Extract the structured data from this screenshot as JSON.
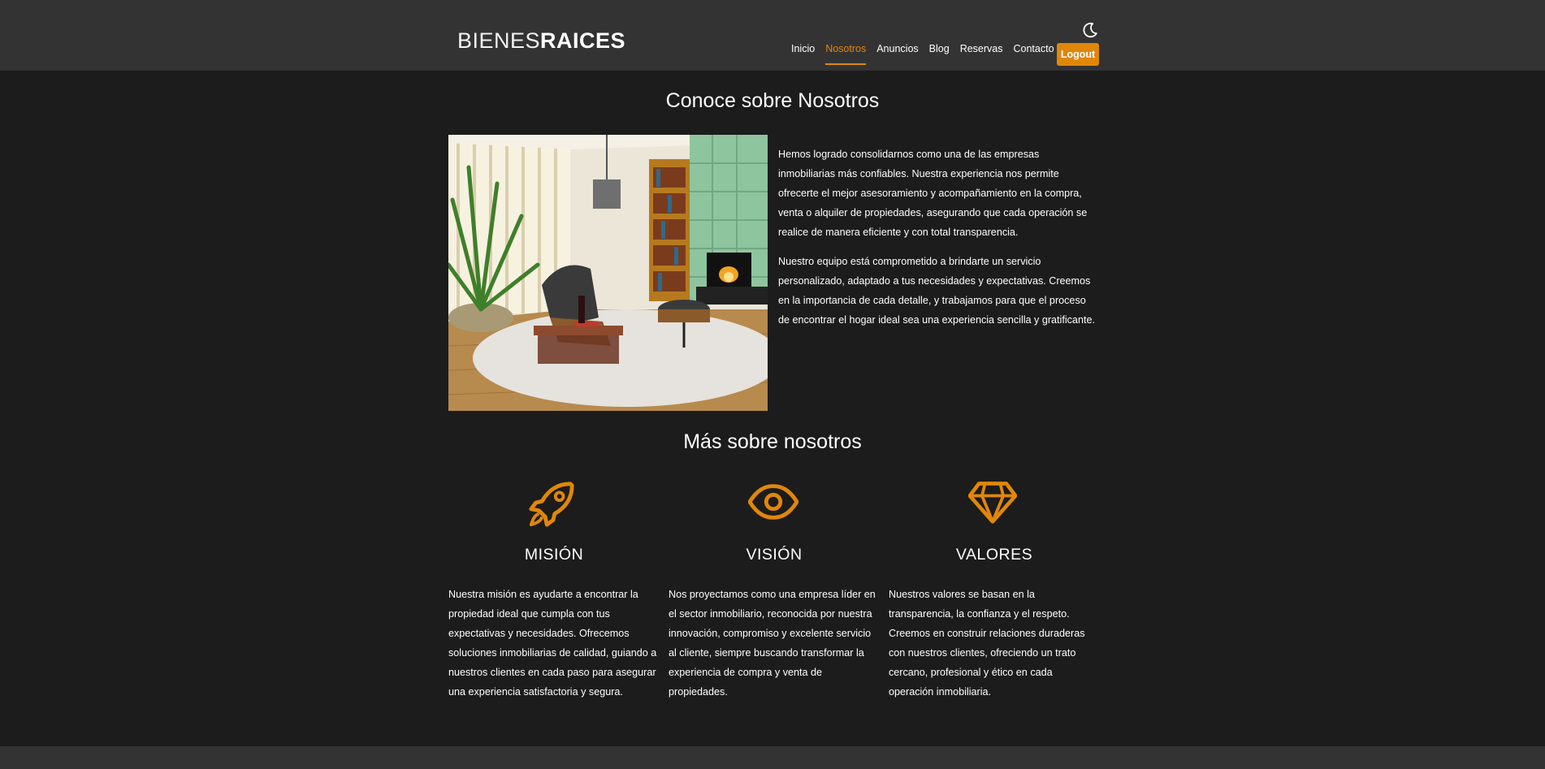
{
  "header": {
    "logo_light": "BIENES",
    "logo_bold": "RAICES",
    "nav": [
      {
        "label": "Inicio",
        "active": false
      },
      {
        "label": "Nosotros",
        "active": true
      },
      {
        "label": "Anuncios",
        "active": false
      },
      {
        "label": "Blog",
        "active": false
      },
      {
        "label": "Reservas",
        "active": false
      },
      {
        "label": "Contacto",
        "active": false
      }
    ],
    "logout_label": "Logout",
    "theme_icon": "moon-icon"
  },
  "about": {
    "title": "Conoce sobre Nosotros",
    "paragraphs": [
      "Hemos logrado consolidarnos como una de las empresas inmobiliarias más confiables. Nuestra experiencia nos permite ofrecerte el mejor asesoramiento y acompañamiento en la compra, venta o alquiler de propiedades, asegurando que cada operación se realice de manera eficiente y con total transparencia.",
      "Nuestro equipo está comprometido a brindarte un servicio personalizado, adaptado a tus necesidades y expectativas. Creemos en la importancia de cada detalle, y trabajamos para que el proceso de encontrar el hogar ideal sea una experiencia sencilla y gratificante."
    ]
  },
  "more": {
    "title": "Más sobre nosotros",
    "items": [
      {
        "icon": "rocket-icon",
        "title": "MISIÓN",
        "text": "Nuestra misión es ayudarte a encontrar la propiedad ideal que cumpla con tus expectativas y necesidades. Ofrecemos soluciones inmobiliarias de calidad, guiando a nuestros clientes en cada paso para asegurar una experiencia satisfactoria y segura."
      },
      {
        "icon": "eye-icon",
        "title": "VISIÓN",
        "text": "Nos proyectamos como una empresa líder en el sector inmobiliario, reconocida por nuestra innovación, compromiso y excelente servicio al cliente, siempre buscando transformar la experiencia de compra y venta de propiedades."
      },
      {
        "icon": "diamond-icon",
        "title": "VALORES",
        "text": "Nuestros valores se basan en la transparencia, la confianza y el respeto. Creemos en construir relaciones duraderas con nuestros clientes, ofreciendo un trato cercano, profesional y ético en cada operación inmobiliaria."
      }
    ]
  },
  "colors": {
    "accent": "#e08709",
    "header_bg": "#333333",
    "page_bg": "#1c1c1c"
  }
}
